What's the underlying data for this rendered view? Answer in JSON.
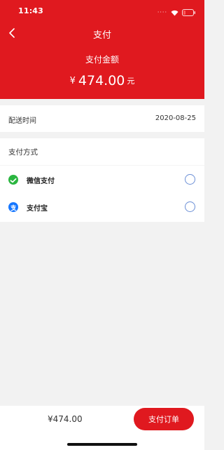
{
  "status_bar": {
    "time": "11:43",
    "signal": "····"
  },
  "nav": {
    "title": "支付"
  },
  "summary": {
    "label": "支付金额",
    "currency": "¥",
    "amount": "474.00",
    "unit": "元"
  },
  "delivery": {
    "label": "配送时间",
    "value": "2020-08-25"
  },
  "payment": {
    "title": "支付方式",
    "options": [
      {
        "label": "微信支付",
        "icon": "wechat-pay-icon",
        "color": "#2bb640"
      },
      {
        "label": "支付宝",
        "icon": "alipay-icon",
        "color": "#1677ff"
      }
    ]
  },
  "footer": {
    "total": "¥474.00",
    "pay_button": "支付订单"
  },
  "colors": {
    "brand": "#e0191f",
    "background": "#f2f2f2",
    "radio": "#6b8fd6"
  }
}
